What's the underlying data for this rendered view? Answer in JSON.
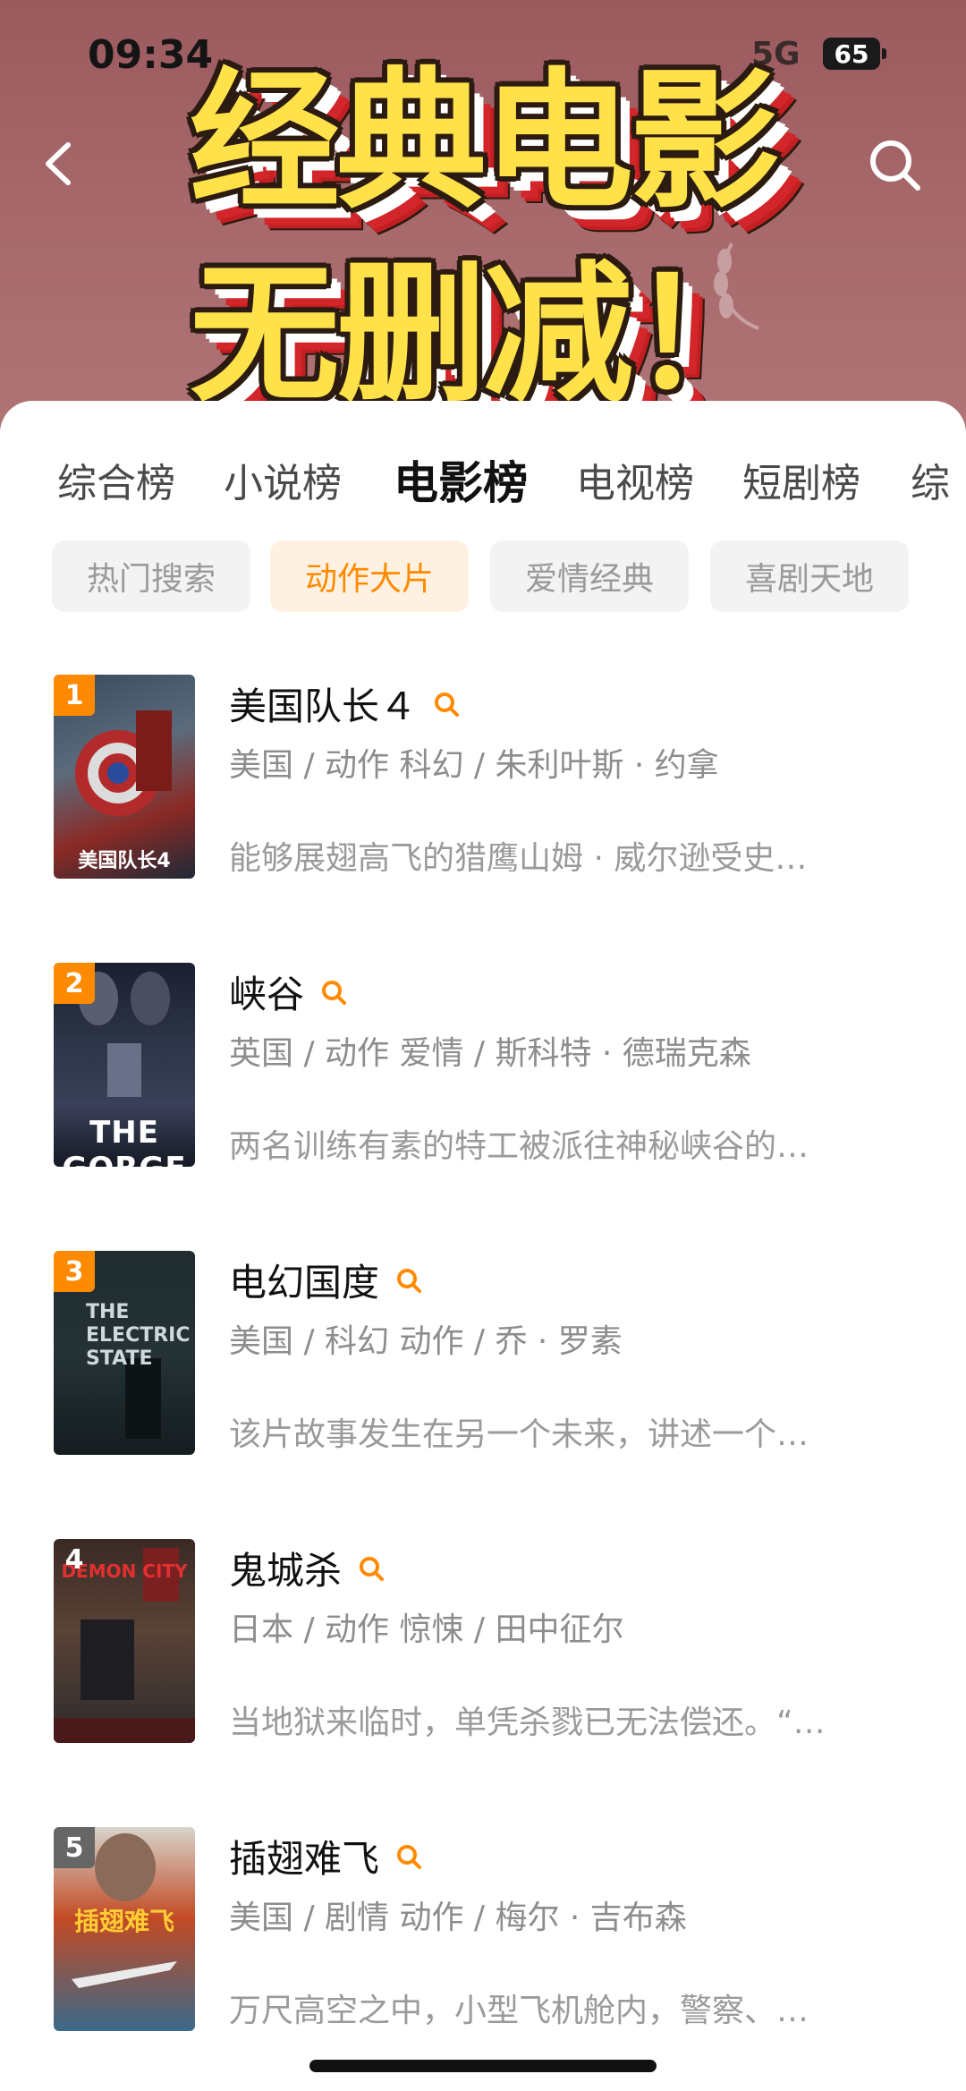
{
  "status_bar": {
    "time": "09:34",
    "network": "5G",
    "battery": "65"
  },
  "banner": {
    "line1": "经典电影",
    "line2": "无删减！"
  },
  "nav": {
    "back": "back-icon",
    "search": "search-icon"
  },
  "tabs": [
    {
      "label": "综合榜",
      "active": false
    },
    {
      "label": "小说榜",
      "active": false
    },
    {
      "label": "电影榜",
      "active": true
    },
    {
      "label": "电视榜",
      "active": false
    },
    {
      "label": "短剧榜",
      "active": false
    },
    {
      "label": "综",
      "active": false
    }
  ],
  "chips": [
    {
      "label": "热门搜索",
      "active": false
    },
    {
      "label": "动作大片",
      "active": true
    },
    {
      "label": "爱情经典",
      "active": false
    },
    {
      "label": "喜剧天地",
      "active": false
    }
  ],
  "movies": [
    {
      "rank": "1",
      "title": "美国队长４",
      "meta": "美国 / 动作 科幻 / 朱利叶斯 · 约拿",
      "desc": "能够展翅高飞的猎鹰山姆 · 威尔逊受史…",
      "poster_text": "美国队长4"
    },
    {
      "rank": "2",
      "title": "峡谷",
      "meta": "英国 / 动作 爱情 / 斯科特 · 德瑞克森",
      "desc": "两名训练有素的特工被派往神秘峡谷的…",
      "poster_text": "THE GORGE"
    },
    {
      "rank": "3",
      "title": "电幻国度",
      "meta": "美国 / 科幻 动作 / 乔 · 罗素",
      "desc": "该片故事发生在另一个未来，讲述一个…",
      "poster_text": "THE ELECTRIC STATE"
    },
    {
      "rank": "4",
      "title": "鬼城杀",
      "meta": "日本 / 动作 惊悚 / 田中征尔",
      "desc": "当地狱来临时，单凭杀戮已无法偿还。“…",
      "poster_text": "DEMON CITY"
    },
    {
      "rank": "5",
      "title": "插翅难飞",
      "meta": "美国 / 剧情 动作 / 梅尔 · 吉布森",
      "desc": "万尺高空之中，小型飞机舱内，警察、…",
      "poster_text": "插翅难飞"
    }
  ],
  "colors": {
    "accent": "#ff8a00",
    "header_bg": "#a86a6c",
    "banner_yellow": "#ffe14a"
  }
}
